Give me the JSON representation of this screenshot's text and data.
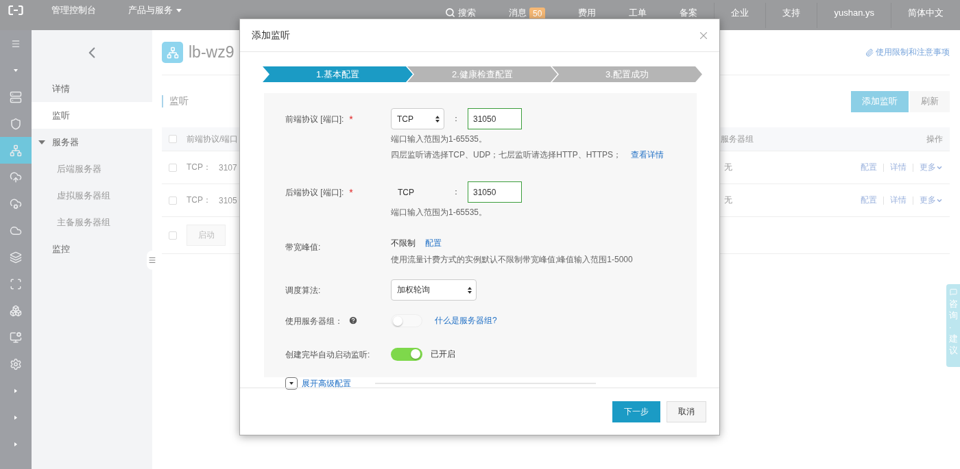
{
  "topbar": {
    "console": "管理控制台",
    "products": "产品与服务",
    "search": "搜索",
    "messages": {
      "label": "消息",
      "badge": "50"
    },
    "nav": [
      "费用",
      "工单",
      "备案",
      "企业",
      "支持",
      "yushan.ys",
      "简体中文"
    ]
  },
  "rail_items": [
    {
      "selected": false
    },
    {
      "selected": false
    },
    {
      "selected": true
    },
    {
      "selected": false
    },
    {
      "selected": false
    },
    {
      "selected": false
    },
    {
      "selected": false
    },
    {
      "selected": false
    },
    {
      "selected": false
    },
    {
      "selected": false
    },
    {
      "selected": false
    }
  ],
  "sidebar": {
    "items": [
      {
        "label": "详情",
        "selected": false
      },
      {
        "label": "监听",
        "selected": true
      },
      {
        "label": "服务器",
        "selected": false,
        "expanded": true,
        "children": [
          {
            "label": "后端服务器",
            "selected": false
          },
          {
            "label": "虚拟服务器组",
            "selected": false
          },
          {
            "label": "主备服务器组",
            "selected": false
          }
        ]
      },
      {
        "label": "监控",
        "selected": false
      }
    ]
  },
  "header": {
    "title": "lb-wz9",
    "link": "使用限制和注意事项"
  },
  "section": {
    "title": "监听",
    "buttons": [
      {
        "label": "添加监听",
        "primary": true
      },
      {
        "label": "刷新",
        "primary": false
      }
    ]
  },
  "table": {
    "header": {
      "checked": false,
      "column_1": "前端协议/端口",
      "column_2": "服务器组",
      "column_3": "操作"
    },
    "rows": [
      {
        "checked": false,
        "protocol": "TCP：",
        "port": "3107",
        "server_group": "无",
        "actions": [
          "配置",
          "详情",
          "更多"
        ]
      },
      {
        "checked": false,
        "protocol": "TCP：",
        "port": "3105",
        "server_group": "无",
        "actions": [
          "配置",
          "详情",
          "更多"
        ]
      }
    ],
    "footer": {
      "checked": false,
      "button": "启动"
    }
  },
  "side_tab": {
    "label": "咨询·建议"
  },
  "dialog": {
    "title": "添加监听",
    "steps": [
      {
        "label": "1.基本配置",
        "selected": true
      },
      {
        "label": "2.健康检查配置",
        "selected": false
      },
      {
        "label": "3.配置成功",
        "selected": false
      }
    ],
    "fields": [
      {
        "kind": "port",
        "label": "前端协议 [端口]:",
        "required_mark": "*",
        "protocol": "TCP",
        "protocol_editable": true,
        "separator": "：",
        "port": "31050",
        "hints": [
          {
            "text": "端口输入范围为1-65535。"
          },
          {
            "text": "四层监听请选择TCP、UDP；七层监听请选择HTTP、HTTPS；",
            "link": "查看详情"
          }
        ]
      },
      {
        "kind": "port",
        "label": "后端协议 [端口]:",
        "required_mark": "*",
        "protocol": "TCP",
        "protocol_editable": false,
        "separator": "：",
        "port": "31050",
        "hints": [
          {
            "text": "端口输入范围为1-65535。"
          }
        ]
      },
      {
        "kind": "value",
        "label": "带宽峰值:",
        "value": "不限制",
        "link": "配置",
        "hints": [
          {
            "text": "使用流量计费方式的实例默认不限制带宽峰值;峰值输入范围1-5000"
          }
        ]
      },
      {
        "kind": "select",
        "label": "调度算法:",
        "value": "加权轮询"
      },
      {
        "kind": "switch",
        "label": "使用服务器组：",
        "help": true,
        "on": false,
        "link": "什么是服务器组?"
      },
      {
        "kind": "switch",
        "label": "创建完毕自动启动监听:",
        "on": true,
        "status": "已开启"
      }
    ],
    "advanced": {
      "label": "展开高级配置",
      "expanded": false
    },
    "buttons": [
      {
        "label": "下一步",
        "primary": true
      },
      {
        "label": "取消",
        "primary": false
      }
    ]
  }
}
